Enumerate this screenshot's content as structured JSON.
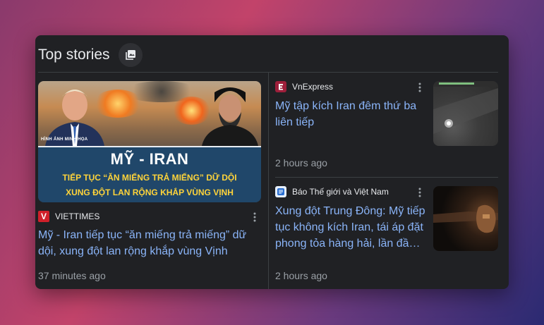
{
  "header": {
    "title": "Top stories"
  },
  "left_story": {
    "source": "VIETTIMES",
    "headline_line1": "Mỹ - Iran tiếp tục “ăn miếng trả miếng” dữ",
    "headline_line2": "dội, xung đột lan rộng khắp vùng Vịnh",
    "time": "37 minutes ago",
    "image": {
      "caption": "HÌNH ẢNH MINH HỌA",
      "title": "MỸ - IRAN",
      "subtitle1": "TIẾP TỤC “ĂN MIẾNG TRẢ MIẾNG” DỮ DỘI",
      "subtitle2": "XUNG ĐỘT LAN RỘNG KHẮP VÙNG VỊNH"
    }
  },
  "right_stories": [
    {
      "source": "VnExpress",
      "headline_line1": "Mỹ tập kích Iran đêm thứ ba",
      "headline_line2": "liên tiếp",
      "time": "2 hours ago"
    },
    {
      "source": "Báo Thế giới và Việt Nam",
      "headline_line1": "Xung đột Trung Đông: Mỹ tiếp",
      "headline_line2": "tục không kích Iran, tái áp đặt",
      "headline_line3": "phong tỏa hàng hải, lần đầ…",
      "time": "2 hours ago"
    }
  ],
  "colors": {
    "panel_bg": "#202124",
    "headline": "#8ab4f8",
    "muted": "#9aa0a6",
    "text": "#e8eaed"
  }
}
